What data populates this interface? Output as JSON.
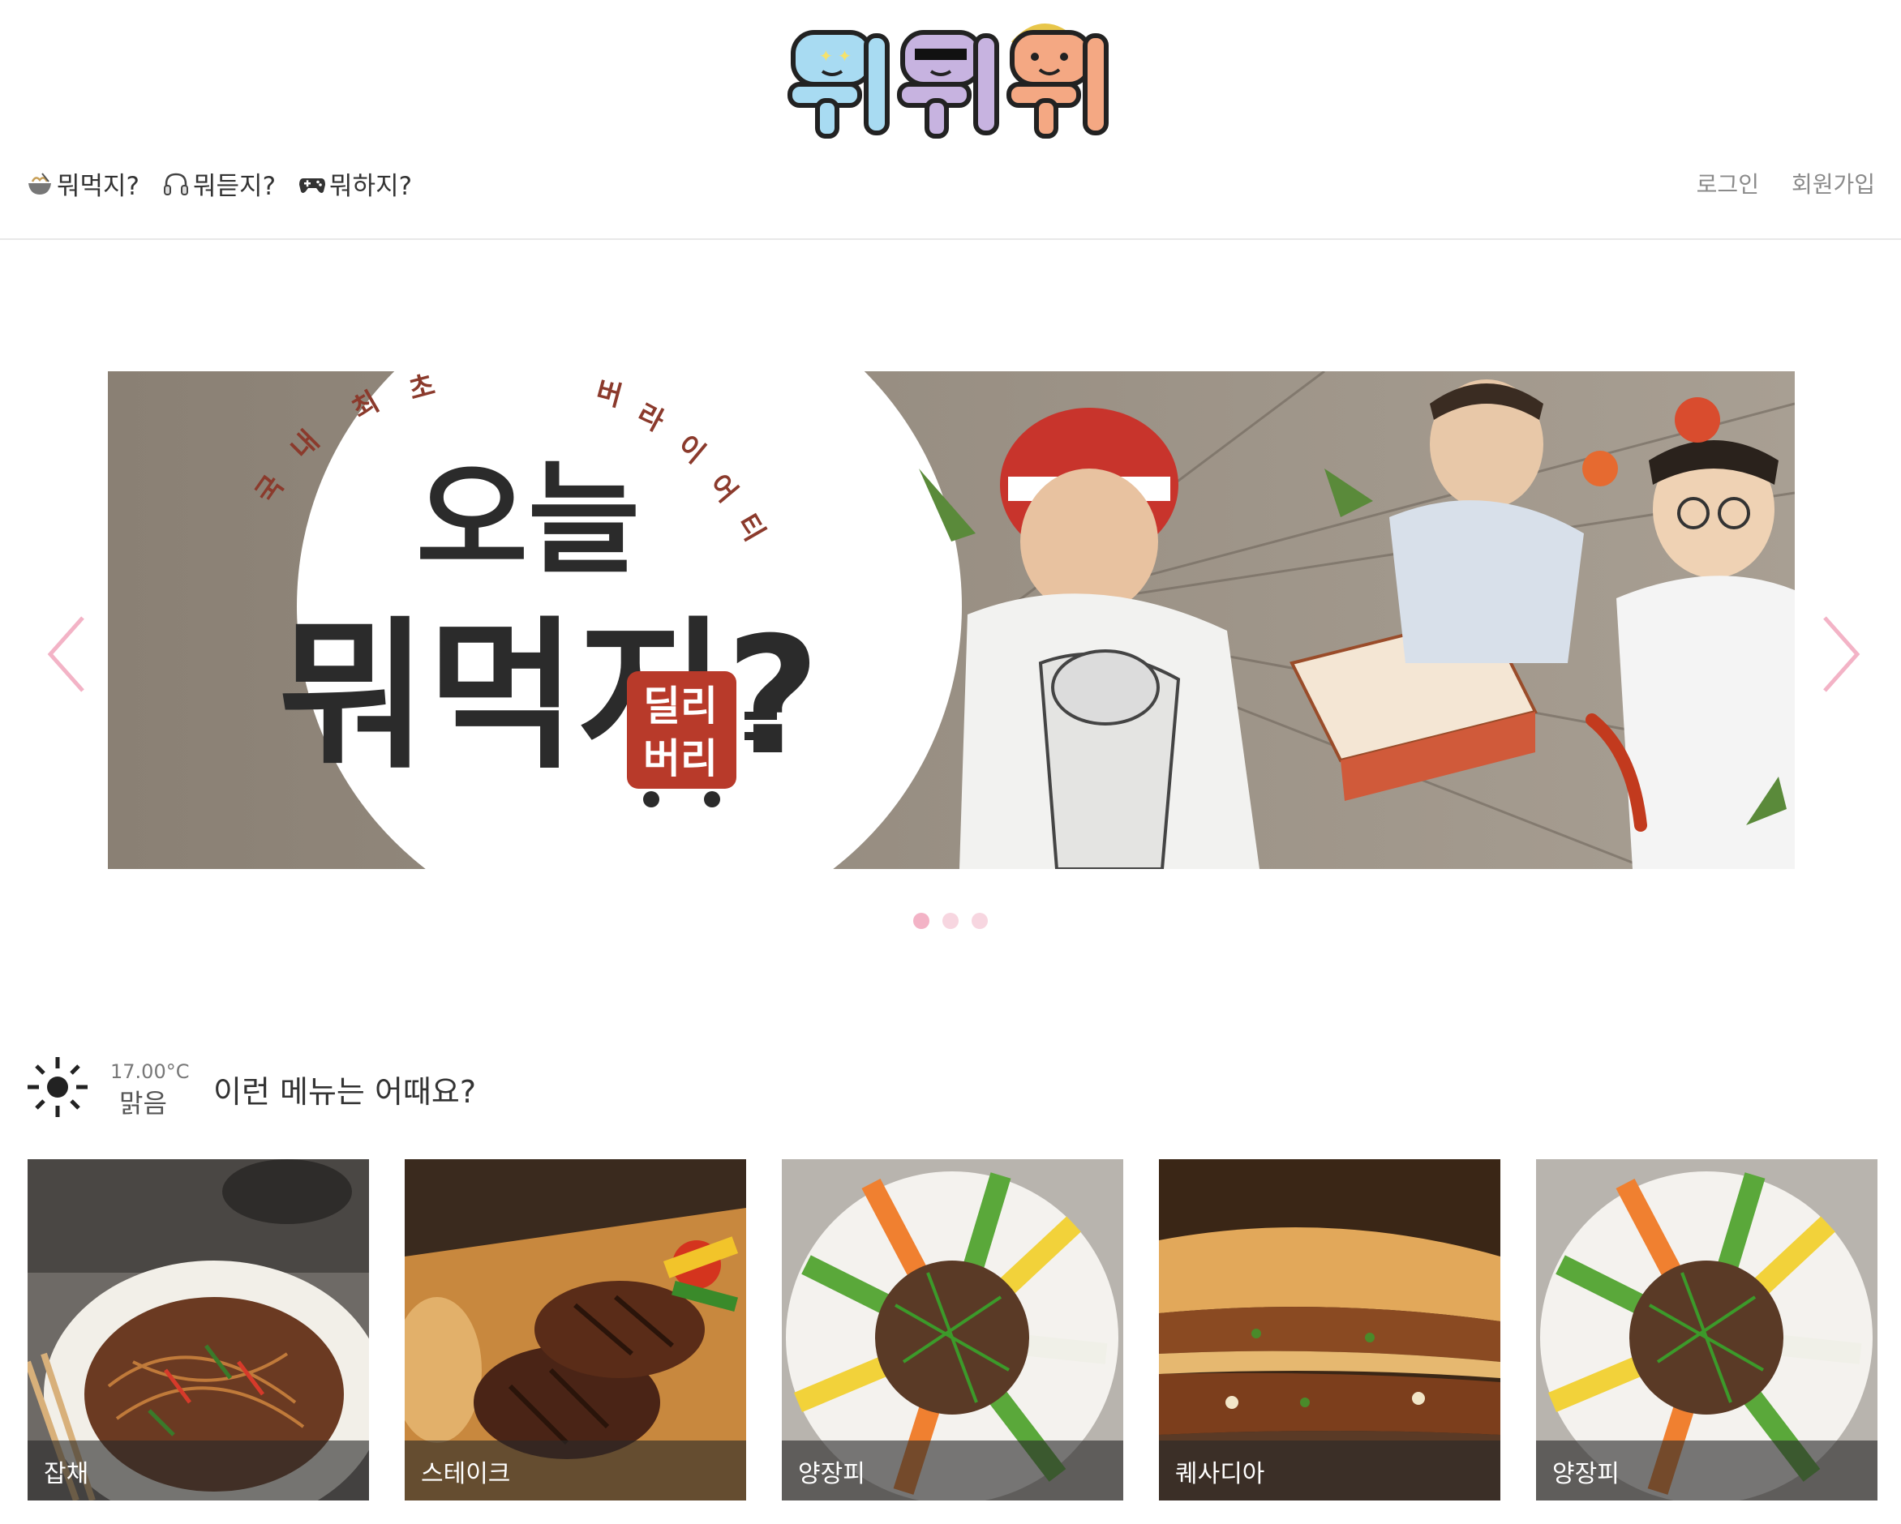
{
  "header": {
    "logo_text": "뭐뭐뭐",
    "nav": [
      {
        "label": "뭐먹지?",
        "icon": "noodle-bowl-icon"
      },
      {
        "label": "뭐듣지?",
        "icon": "headphones-icon"
      },
      {
        "label": "뭐하지?",
        "icon": "gamepad-icon"
      }
    ],
    "auth": {
      "login": "로그인",
      "signup": "회원가입"
    }
  },
  "carousel": {
    "banner": {
      "title_lines": [
        "오늘",
        "뭐먹지?"
      ],
      "arc_text": "국내 최초 ... 버라이어티",
      "badge_lines": [
        "딜리",
        "버리"
      ]
    },
    "slide_count": 3,
    "active_index": 0
  },
  "weather": {
    "temperature": "17.00°C",
    "condition": "맑음",
    "icon": "sun-icon"
  },
  "recommend": {
    "title": "이런 메뉴는 어때요?",
    "items": [
      {
        "name": "잡채"
      },
      {
        "name": "스테이크"
      },
      {
        "name": "양장피"
      },
      {
        "name": "퀘사디아"
      },
      {
        "name": "양장피"
      }
    ]
  },
  "colors": {
    "accent_pink": "#f3b3c6",
    "logo_blue": "#a8dbf2",
    "logo_purple": "#c7b3e0",
    "logo_orange": "#f4a883"
  }
}
